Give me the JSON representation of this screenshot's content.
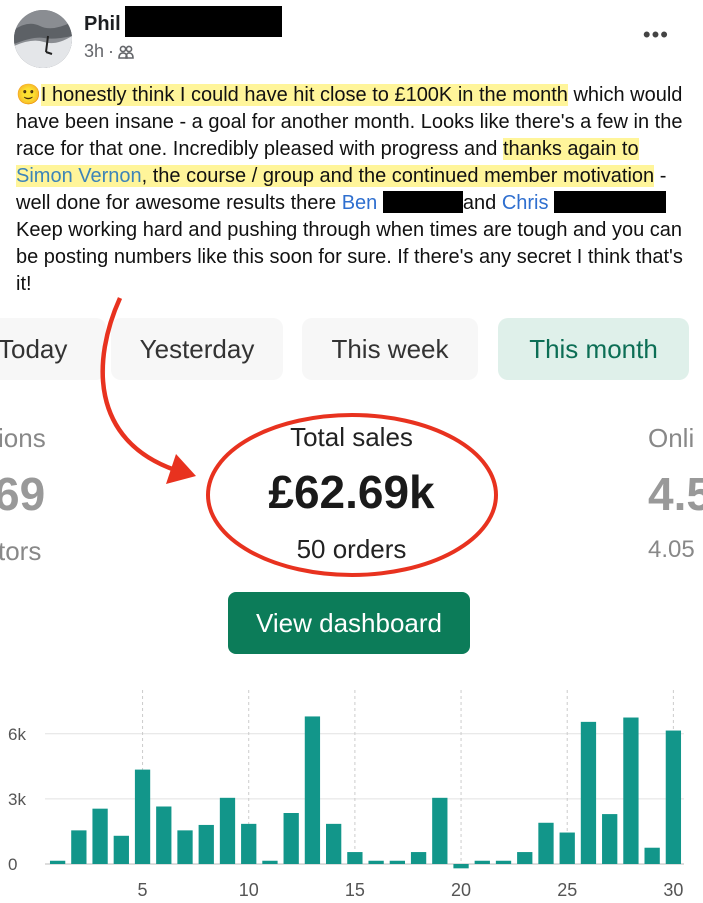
{
  "post": {
    "author": "Phil",
    "time": "3h",
    "privacy_icon": "friends-icon",
    "more_label": "•••",
    "text": [
      {
        "type": "emoji",
        "text": "🙂"
      },
      {
        "type": "highlight",
        "text": "I honestly think I could have hit close to £100K in the month"
      },
      {
        "type": "plain",
        "text": " which would have been insane - a goal for another month. Looks like there's a few in the race for that one. Incredibly pleased with progress and "
      },
      {
        "type": "highlight",
        "text": "thanks again to "
      },
      {
        "type": "highlight-link",
        "text": "Simon Vernon"
      },
      {
        "type": "highlight",
        "text": ", the course / group and the continued member motivation"
      },
      {
        "type": "plain",
        "text": " - well done for awesome results there "
      },
      {
        "type": "link",
        "text": "Ben"
      },
      {
        "type": "plain",
        "text": " "
      },
      {
        "type": "redacted",
        "width": 80
      },
      {
        "type": "plain",
        "text": "and "
      },
      {
        "type": "link",
        "text": "Chris"
      },
      {
        "type": "plain",
        "text": " "
      },
      {
        "type": "redacted",
        "width": 112
      },
      {
        "type": "plain",
        "text": "Keep working hard and pushing through when times are tough and you can be posting numbers like this soon for sure. If there's any secret I think that's it!"
      }
    ]
  },
  "dashboard": {
    "tabs": [
      "Today",
      "Yesterday",
      "This week",
      "This month"
    ],
    "active_tab": "This month",
    "left_stat": {
      "label": "ions",
      "value": "69",
      "sub": "tors"
    },
    "total": {
      "label": "Total sales",
      "value": "£62.69k",
      "orders": "50 orders"
    },
    "right_stat": {
      "label": "Onli",
      "value": "4.5",
      "sub": "4.05"
    },
    "button_label": "View dashboard"
  },
  "annotations": {
    "color": "#e8321f"
  },
  "chart_data": {
    "type": "bar",
    "x": [
      1,
      2,
      3,
      4,
      5,
      6,
      7,
      8,
      9,
      10,
      11,
      12,
      13,
      14,
      15,
      16,
      17,
      18,
      19,
      20,
      21,
      22,
      23,
      24,
      25,
      26,
      27,
      28,
      29,
      30
    ],
    "values": [
      0.15,
      1.55,
      2.55,
      1.3,
      4.35,
      2.65,
      1.55,
      1.8,
      3.05,
      1.85,
      0.15,
      2.35,
      6.8,
      1.85,
      0.55,
      0.15,
      0.15,
      0.55,
      3.05,
      -0.2,
      0.15,
      0.15,
      0.55,
      1.9,
      1.45,
      6.55,
      2.3,
      6.75,
      0.75,
      6.15
    ],
    "xticks": [
      "5",
      "10",
      "15",
      "20",
      "25",
      "30"
    ],
    "yticks": [
      "0",
      "3k",
      "6k"
    ],
    "ylim": [
      -0.5,
      7
    ],
    "bar_color": "#12968a",
    "grid": true
  }
}
